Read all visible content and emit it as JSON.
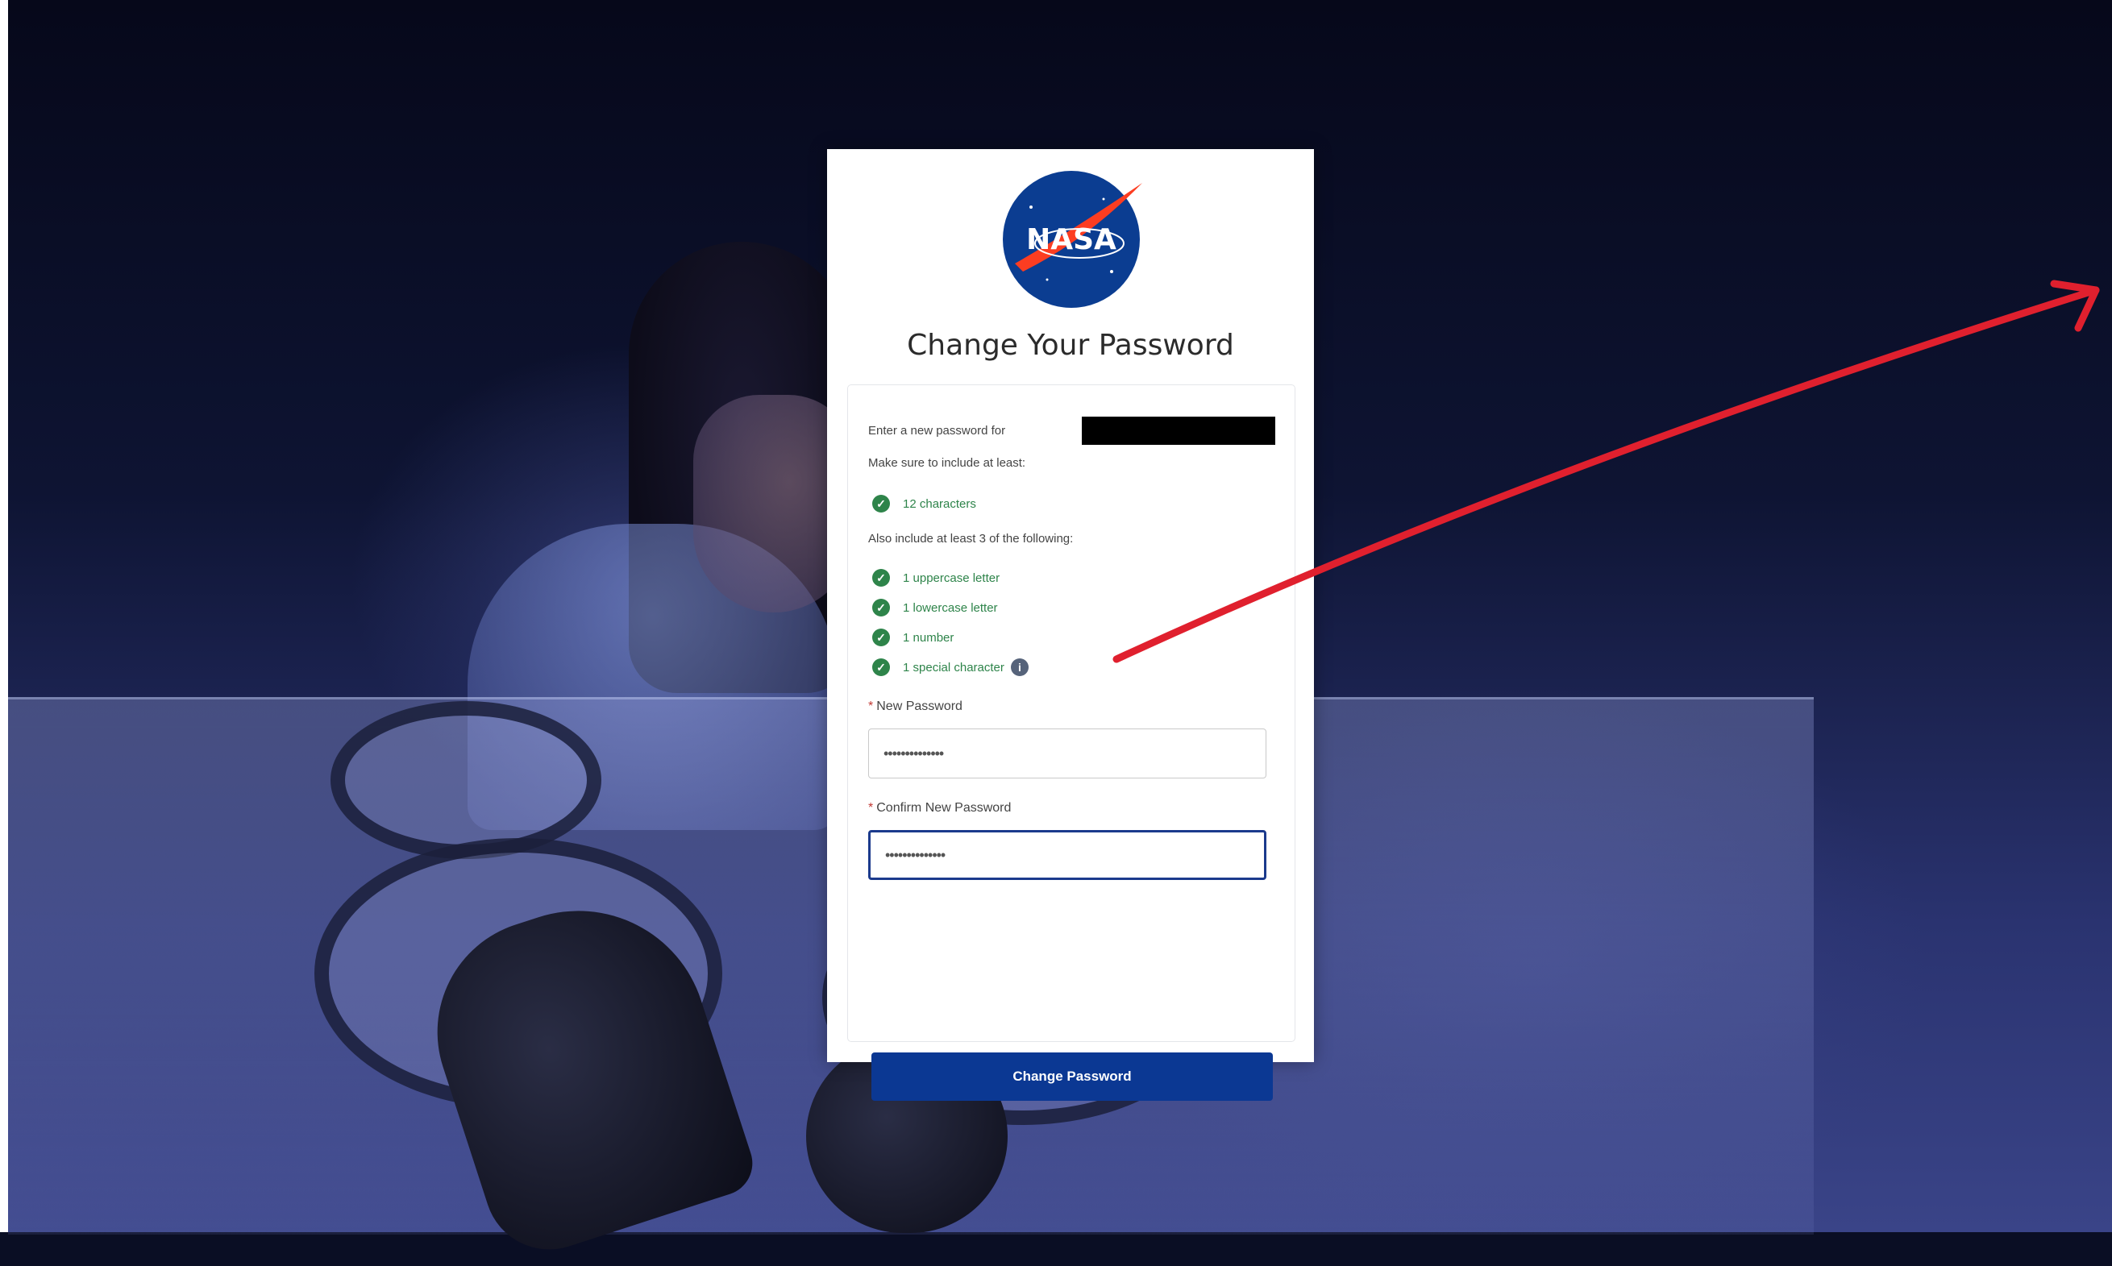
{
  "background": {
    "description_icon": "scientist-photo"
  },
  "card": {
    "logo_text": "NASA",
    "title": "Change Your Password",
    "intro": "Enter a new password for",
    "make_sure": "Make sure to include at least:",
    "min_requirement": "12 characters",
    "also_include": "Also include at least 3 of the following:",
    "requirements": [
      "1 uppercase letter",
      "1 lowercase letter",
      "1 number",
      "1 special character"
    ],
    "info_icon_glyph": "i",
    "new_password_label": "New Password",
    "new_password_value": "••••••••••••••",
    "confirm_password_label": "Confirm New Password",
    "confirm_password_value": "••••••••••••••",
    "submit_label": "Change Password",
    "required_marker": "*",
    "check_glyph": "✓"
  },
  "colors": {
    "accent": "#0b3893",
    "success": "#2e844a",
    "annotation_arrow": "#e0202e",
    "nasa_blue": "#0b3d91",
    "nasa_red": "#fc3d21"
  }
}
